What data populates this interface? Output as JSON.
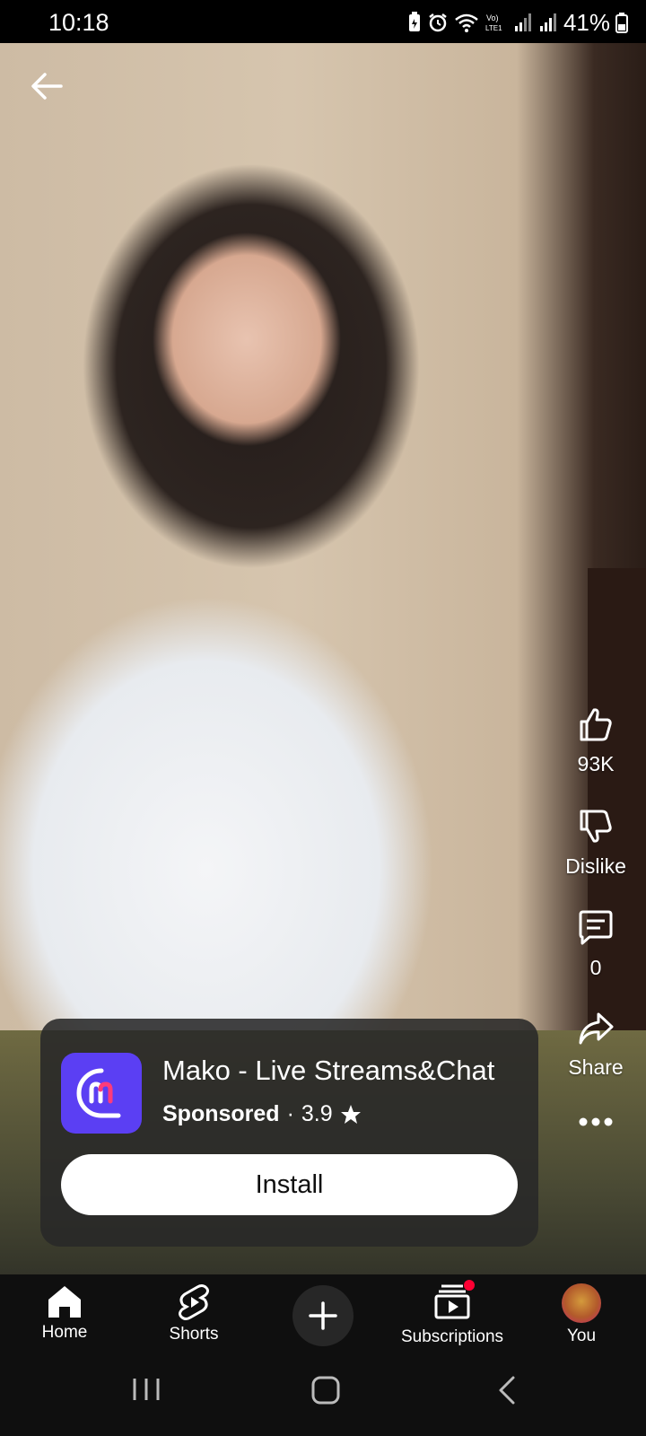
{
  "status_bar": {
    "time": "10:18",
    "battery": "41%",
    "icons": [
      "battery-saver-icon",
      "alarm-icon",
      "wifi-icon",
      "volte-icon",
      "signal-icon",
      "signal-icon",
      "battery-icon"
    ]
  },
  "video": {
    "back_icon": "arrow-left-icon"
  },
  "actions": {
    "like_count": "93K",
    "dislike_label": "Dislike",
    "comment_count": "0",
    "share_label": "Share",
    "more_icon": "more-horizontal-icon"
  },
  "ad": {
    "app_name": "Mako - Live Streams&Chat",
    "sponsored": "Sponsored",
    "separator": "·",
    "rating": "3.9",
    "install_label": "Install",
    "icon_color": "#5b3ff3"
  },
  "bottom_nav": {
    "items": [
      {
        "label": "Home",
        "icon": "home-icon"
      },
      {
        "label": "Shorts",
        "icon": "shorts-icon"
      },
      {
        "label": "",
        "icon": "plus-icon"
      },
      {
        "label": "Subscriptions",
        "icon": "subscriptions-icon"
      },
      {
        "label": "You",
        "icon": "avatar"
      }
    ]
  },
  "colors": {
    "accent_red": "#ff0033",
    "nav_bg": "#0f0f0f"
  }
}
